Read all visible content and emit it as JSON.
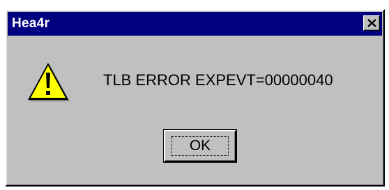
{
  "window": {
    "title": "Hea4r",
    "close_icon": "close-x-icon"
  },
  "content": {
    "icon": "warning-triangle-icon",
    "message": "TLB ERROR EXPEVT=00000040"
  },
  "buttons": {
    "ok_label": "OK"
  }
}
